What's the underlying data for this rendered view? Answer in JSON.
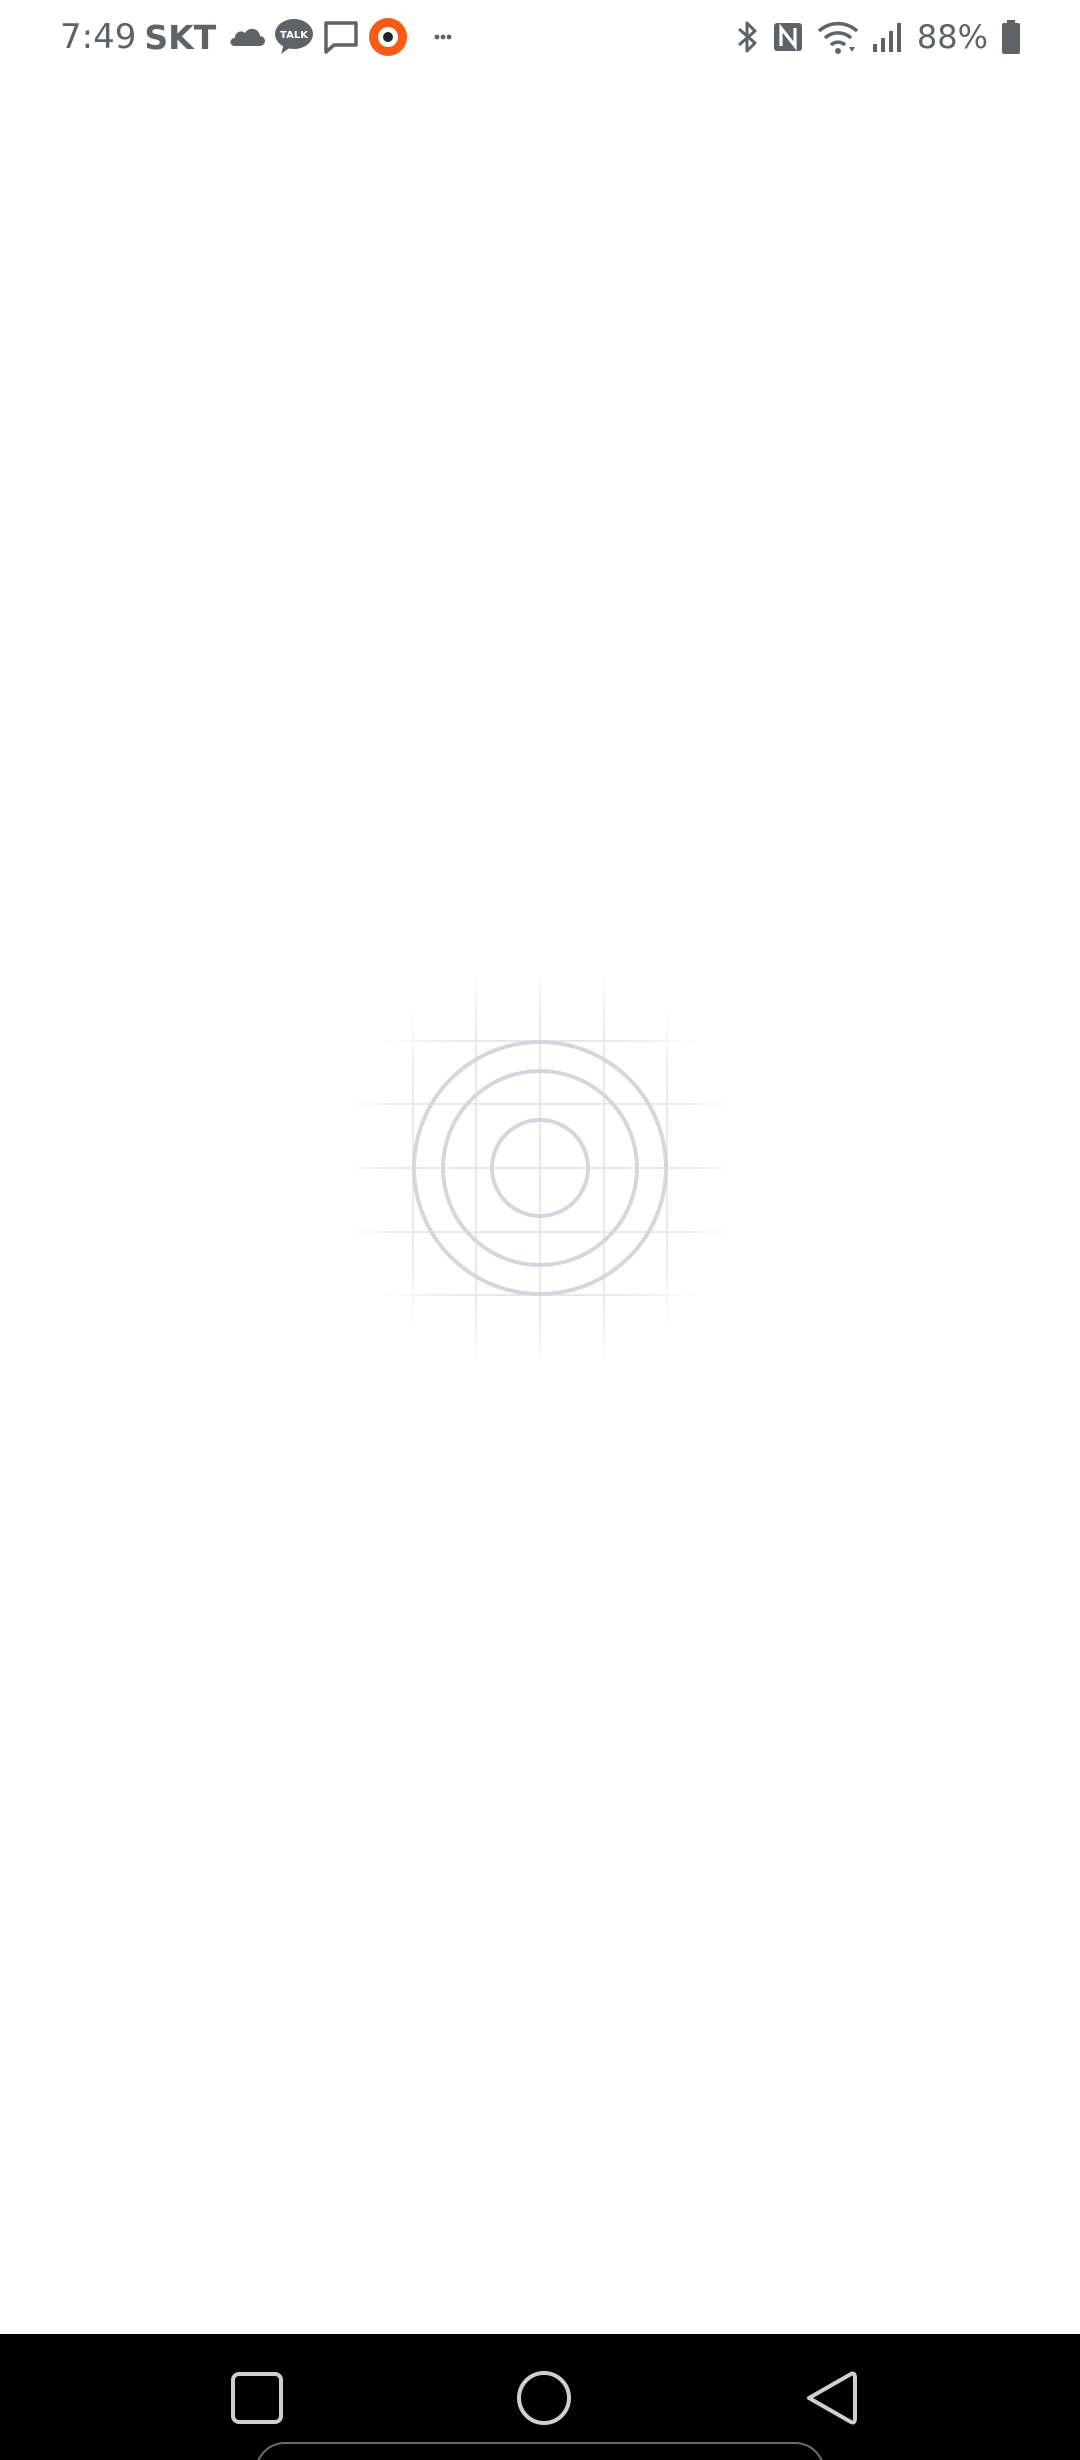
{
  "status_bar": {
    "time": "7:49",
    "carrier": "SKT",
    "talk_badge": "TALK",
    "more_dots": "•••",
    "battery_percent": "88%",
    "icons_left": [
      "cloud-icon",
      "kakaotalk-icon",
      "message-icon",
      "record-icon",
      "more-notifications-icon"
    ],
    "icons_right": [
      "bluetooth-icon",
      "nfc-icon",
      "wifi-icon",
      "signal-icon",
      "battery-icon"
    ]
  },
  "main": {
    "loading_graphic": "concentric-circles-grid-icon"
  },
  "nav_bar": {
    "buttons": [
      "recent-apps",
      "home",
      "back"
    ]
  },
  "colors": {
    "status_text": "#5f6368",
    "accent_orange": "#fa5a14",
    "circle_stroke": "#d6d6dc",
    "grid_stroke": "#ececf0",
    "nav_background": "#000000",
    "nav_icon": "#cfcfcf"
  }
}
